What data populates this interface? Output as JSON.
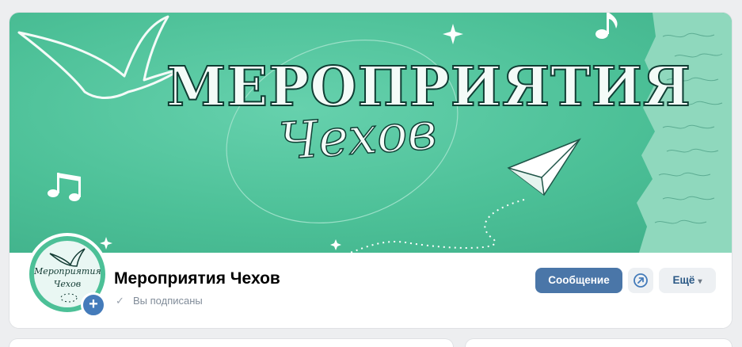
{
  "cover": {
    "title": "МЕРОПРИЯТИЯ",
    "subtitle": "Чехов"
  },
  "avatar": {
    "line1": "Мероприятия",
    "line2": "Чехов"
  },
  "group": {
    "name": "Мероприятия Чехов",
    "status": "Вы подписаны"
  },
  "actions": {
    "message": "Сообщение",
    "more": "Ещё"
  },
  "colors": {
    "cover_green": "#4cc097",
    "primary_button": "#4a76a8",
    "secondary_button": "#edf0f3",
    "background": "#edeef0"
  },
  "icons": {
    "share": "share-arrow-icon",
    "add": "plus-icon",
    "check": "check-icon",
    "chevron": "chevron-down-icon"
  }
}
